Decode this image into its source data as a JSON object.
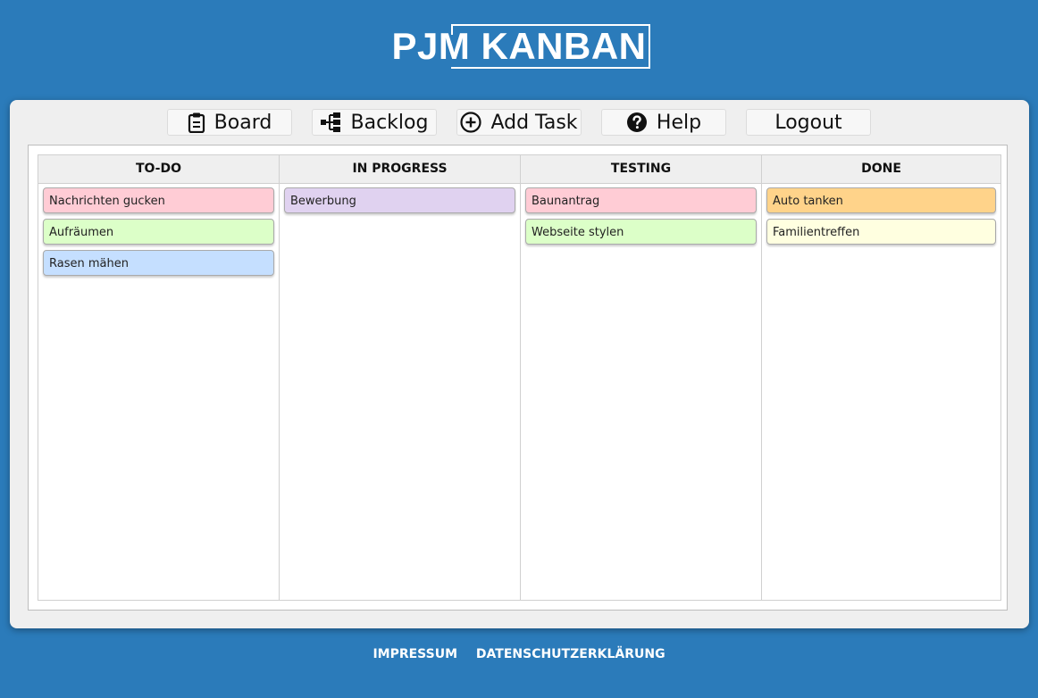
{
  "logo": {
    "text": "PJM KANBAN"
  },
  "nav": {
    "board": "Board",
    "backlog": "Backlog",
    "add_task": "Add Task",
    "help": "Help",
    "logout": "Logout"
  },
  "columns": [
    {
      "title": "TO-DO",
      "cards": [
        {
          "label": "Nachrichten gucken",
          "color": "#ffccd5"
        },
        {
          "label": "Aufräumen",
          "color": "#dcffc8"
        },
        {
          "label": "Rasen mähen",
          "color": "#c5dfff"
        }
      ]
    },
    {
      "title": "IN PROGRESS",
      "cards": [
        {
          "label": "Bewerbung",
          "color": "#e0d2f0"
        }
      ]
    },
    {
      "title": "TESTING",
      "cards": [
        {
          "label": "Baunantrag",
          "color": "#ffccd5"
        },
        {
          "label": "Webseite stylen",
          "color": "#dcffc8"
        }
      ]
    },
    {
      "title": "DONE",
      "cards": [
        {
          "label": "Auto tanken",
          "color": "#ffd38a"
        },
        {
          "label": "Familientreffen",
          "color": "#ffffe0"
        }
      ]
    }
  ],
  "footer": {
    "impressum": "IMPRESSUM",
    "datenschutz": "DATENSCHUTZERKLÄRUNG"
  },
  "colors": {
    "background": "#2b7bba",
    "panel": "#efefef"
  }
}
